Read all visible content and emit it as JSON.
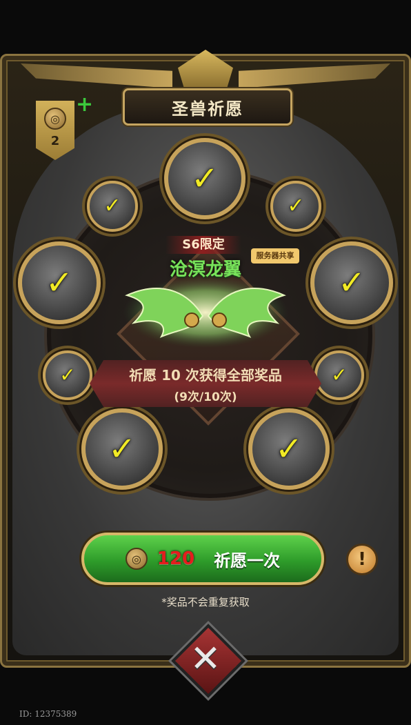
{
  "header": {
    "title": "圣兽祈愿"
  },
  "currency": {
    "icon": "coin-icon",
    "count": "2",
    "add_label": "+"
  },
  "event": {
    "tag": "S6限定",
    "name": "沧溟龙翼",
    "share_badge": "服务器共享",
    "progress_text": "祈愿 10 次获得全部奖品",
    "progress_count": "(9次/10次)"
  },
  "rewards": [
    {
      "slot": "top",
      "claimed": true,
      "icon": "grey-beast-portrait-icon"
    },
    {
      "slot": "upper-left-small",
      "claimed": true,
      "icon": "red-mask-icon"
    },
    {
      "slot": "upper-right-small",
      "claimed": true,
      "icon": "purple-crystal-icon"
    },
    {
      "slot": "left",
      "claimed": true,
      "icon": "white-dragon-portrait-icon"
    },
    {
      "slot": "right",
      "claimed": true,
      "icon": "dark-beast-portrait-icon"
    },
    {
      "slot": "lower-left-small",
      "claimed": true,
      "icon": "purple-swirl-icon"
    },
    {
      "slot": "lower-right-small",
      "claimed": true,
      "icon": "purple-crystal-icon"
    },
    {
      "slot": "bottom-left",
      "claimed": true,
      "icon": "red-haired-portrait-icon"
    },
    {
      "slot": "bottom-right",
      "claimed": true,
      "icon": "horned-beast-portrait-icon"
    }
  ],
  "check_glyph": "✓",
  "wish_button": {
    "cost": "120",
    "label": "祈愿一次"
  },
  "info_button": {
    "glyph": "!"
  },
  "note": "*奖品不会重复获取",
  "close_glyph": "✕",
  "footer_id": "ID: 12375389",
  "colors": {
    "accent_gold": "#c7a35b",
    "button_green": "#3fb23a",
    "check_yellow": "#f1ea25",
    "cost_red": "#e51d1d"
  }
}
